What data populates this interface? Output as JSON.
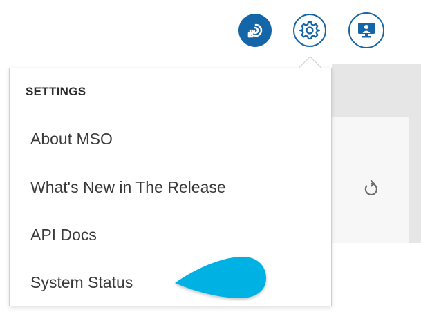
{
  "header": {
    "buttons": [
      {
        "name": "analytics",
        "icon": "spiral-arrow-icon",
        "style": "filled"
      },
      {
        "name": "settings",
        "icon": "gear-icon",
        "style": "outline"
      },
      {
        "name": "display",
        "icon": "monitor-user-icon",
        "style": "outline"
      }
    ]
  },
  "settings_menu": {
    "title": "SETTINGS",
    "items": [
      {
        "label": "About MSO"
      },
      {
        "label": "What's New in The Release"
      },
      {
        "label": "API Docs"
      },
      {
        "label": "System Status"
      }
    ]
  },
  "background": {
    "refresh_icon": "refresh-icon"
  },
  "colors": {
    "accent": "#1566a8",
    "pointer": "#00b2e3",
    "text": "#3a3a3a"
  }
}
